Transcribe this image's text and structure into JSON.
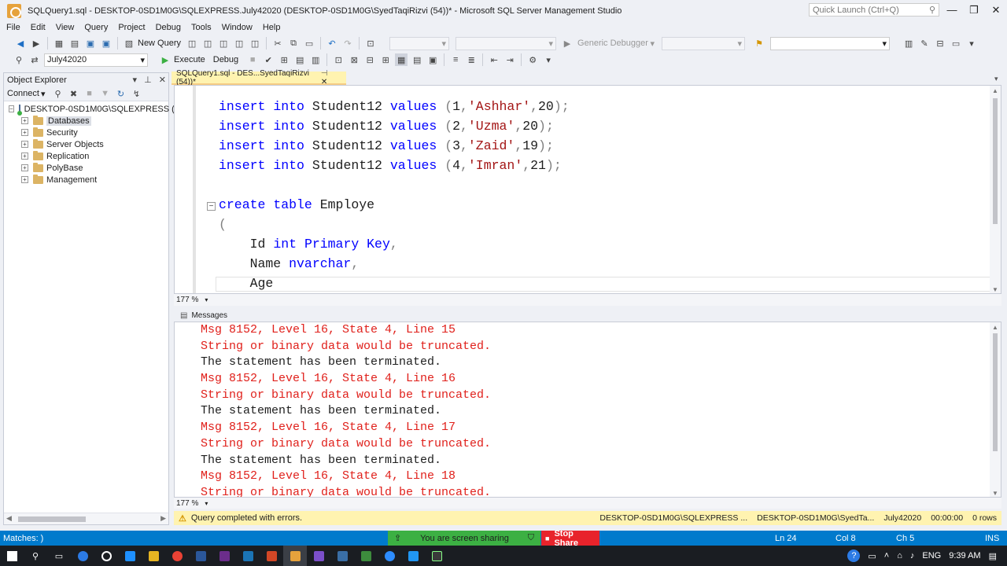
{
  "window": {
    "title": "SQLQuery1.sql - DESKTOP-0SD1M0G\\SQLEXPRESS.July42020 (DESKTOP-0SD1M0G\\SyedTaqiRizvi (54))* - Microsoft SQL Server Management Studio",
    "quick_launch_placeholder": "Quick Launch (Ctrl+Q)"
  },
  "menu": [
    "File",
    "Edit",
    "View",
    "Query",
    "Project",
    "Debug",
    "Tools",
    "Window",
    "Help"
  ],
  "toolbar": {
    "new_query": "New Query",
    "debugger": "Generic Debugger",
    "database": "July42020",
    "execute": "Execute",
    "debug": "Debug"
  },
  "object_explorer": {
    "title": "Object Explorer",
    "connect": "Connect",
    "server": "DESKTOP-0SD1M0G\\SQLEXPRESS (SQL",
    "nodes": [
      "Databases",
      "Security",
      "Server Objects",
      "Replication",
      "PolyBase",
      "Management"
    ]
  },
  "tab": {
    "label": "SQLQuery1.sql - DES...SyedTaqiRizvi (54))*"
  },
  "editor": {
    "zoom": "177 %",
    "lines": [
      [
        [
          "kw",
          "insert"
        ],
        [
          "id",
          " "
        ],
        [
          "kw",
          "into"
        ],
        [
          "id",
          " Student12 "
        ],
        [
          "kw",
          "values"
        ],
        [
          "id",
          " "
        ],
        [
          "op",
          "("
        ],
        [
          "id",
          "1"
        ],
        [
          "op",
          ","
        ],
        [
          "str",
          "'Ashhar'"
        ],
        [
          "op",
          ","
        ],
        [
          "id",
          "20"
        ],
        [
          "op",
          ");"
        ]
      ],
      [
        [
          "kw",
          "insert"
        ],
        [
          "id",
          " "
        ],
        [
          "kw",
          "into"
        ],
        [
          "id",
          " Student12 "
        ],
        [
          "kw",
          "values"
        ],
        [
          "id",
          " "
        ],
        [
          "op",
          "("
        ],
        [
          "id",
          "2"
        ],
        [
          "op",
          ","
        ],
        [
          "str",
          "'Uzma'"
        ],
        [
          "op",
          ","
        ],
        [
          "id",
          "20"
        ],
        [
          "op",
          ");"
        ]
      ],
      [
        [
          "kw",
          "insert"
        ],
        [
          "id",
          " "
        ],
        [
          "kw",
          "into"
        ],
        [
          "id",
          " Student12 "
        ],
        [
          "kw",
          "values"
        ],
        [
          "id",
          " "
        ],
        [
          "op",
          "("
        ],
        [
          "id",
          "3"
        ],
        [
          "op",
          ","
        ],
        [
          "str",
          "'Zaid'"
        ],
        [
          "op",
          ","
        ],
        [
          "id",
          "19"
        ],
        [
          "op",
          ");"
        ]
      ],
      [
        [
          "kw",
          "insert"
        ],
        [
          "id",
          " "
        ],
        [
          "kw",
          "into"
        ],
        [
          "id",
          " Student12 "
        ],
        [
          "kw",
          "values"
        ],
        [
          "id",
          " "
        ],
        [
          "op",
          "("
        ],
        [
          "id",
          "4"
        ],
        [
          "op",
          ","
        ],
        [
          "str",
          "'Imran'"
        ],
        [
          "op",
          ","
        ],
        [
          "id",
          "21"
        ],
        [
          "op",
          ");"
        ]
      ],
      [],
      [
        [
          "kw",
          "create"
        ],
        [
          "id",
          " "
        ],
        [
          "kw",
          "table"
        ],
        [
          "id",
          " Employe"
        ]
      ],
      [
        [
          "op",
          "("
        ]
      ],
      [
        [
          "id",
          "    Id "
        ],
        [
          "kw",
          "int"
        ],
        [
          "id",
          " "
        ],
        [
          "kw",
          "Primary"
        ],
        [
          "id",
          " "
        ],
        [
          "kw",
          "Key"
        ],
        [
          "op",
          ","
        ]
      ],
      [
        [
          "id",
          "    Name "
        ],
        [
          "kw",
          "nvarchar"
        ],
        [
          "op",
          ","
        ]
      ],
      [
        [
          "id",
          "    Age"
        ]
      ]
    ]
  },
  "messages": {
    "tab": "Messages",
    "zoom": "177 %",
    "lines": [
      {
        "t": "err",
        "s": "Msg 8152, Level 16, State 4, Line 15"
      },
      {
        "t": "err",
        "s": "String or binary data would be truncated."
      },
      {
        "t": "norm",
        "s": "The statement has been terminated."
      },
      {
        "t": "err",
        "s": "Msg 8152, Level 16, State 4, Line 16"
      },
      {
        "t": "err",
        "s": "String or binary data would be truncated."
      },
      {
        "t": "norm",
        "s": "The statement has been terminated."
      },
      {
        "t": "err",
        "s": "Msg 8152, Level 16, State 4, Line 17"
      },
      {
        "t": "err",
        "s": "String or binary data would be truncated."
      },
      {
        "t": "norm",
        "s": "The statement has been terminated."
      },
      {
        "t": "err",
        "s": "Msg 8152, Level 16, State 4, Line 18"
      },
      {
        "t": "err",
        "s": "String or binary data would be truncated."
      }
    ]
  },
  "query_status": {
    "text": "Query completed with errors.",
    "server": "DESKTOP-0SD1M0G\\SQLEXPRESS ...",
    "user": "DESKTOP-0SD1M0G\\SyedTa...",
    "database": "July42020",
    "elapsed": "00:00:00",
    "rows": "0 rows"
  },
  "statusbar": {
    "matches": "Matches: )",
    "sharing": "You are screen sharing",
    "stop_share": "Stop Share",
    "ln": "Ln 24",
    "col": "Col 8",
    "ch": "Ch 5",
    "ins": "INS"
  },
  "taskbar": {
    "lang": "ENG",
    "time": "9:39 AM"
  },
  "colors": {
    "keyword": "#0000ff",
    "string": "#a31515",
    "error": "#e0201b",
    "statusbar": "#007acc",
    "tab_active": "#fff3b0"
  }
}
